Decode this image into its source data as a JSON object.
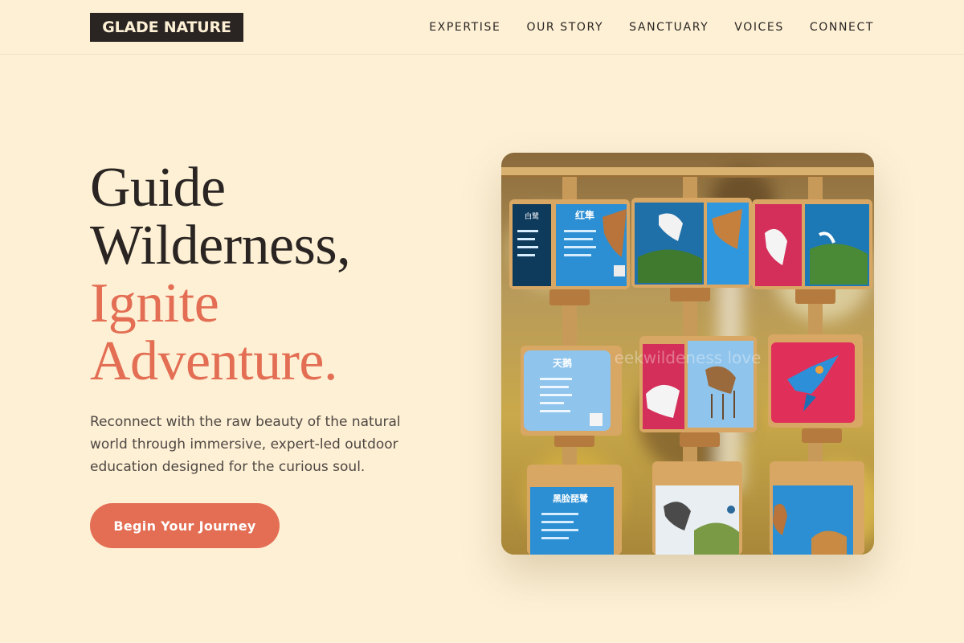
{
  "header": {
    "logo": "GLADE NATURE",
    "nav": [
      "EXPERTISE",
      "OUR STORY",
      "SANCTUARY",
      "VOICES",
      "CONNECT"
    ]
  },
  "hero": {
    "title_line1": "Guide",
    "title_line2": "Wilderness,",
    "title_accent_line1": "Ignite",
    "title_accent_line2": "Adventure.",
    "subtitle": "Reconnect with the raw beauty of the natural world through immersive, expert-led outdoor education designed for the curious soul.",
    "cta_label": "Begin Your Journey",
    "image_sign_texts": {
      "s1_left": "白鹭",
      "s1_right": "红隼",
      "s2": "天鹅",
      "s3": "黑脸琵鹭",
      "watermark": "eekwildeness love"
    }
  },
  "colors": {
    "background": "#fdf0d5",
    "text": "#2a2522",
    "accent": "#e36e53",
    "logo_bg": "#2a2522"
  }
}
